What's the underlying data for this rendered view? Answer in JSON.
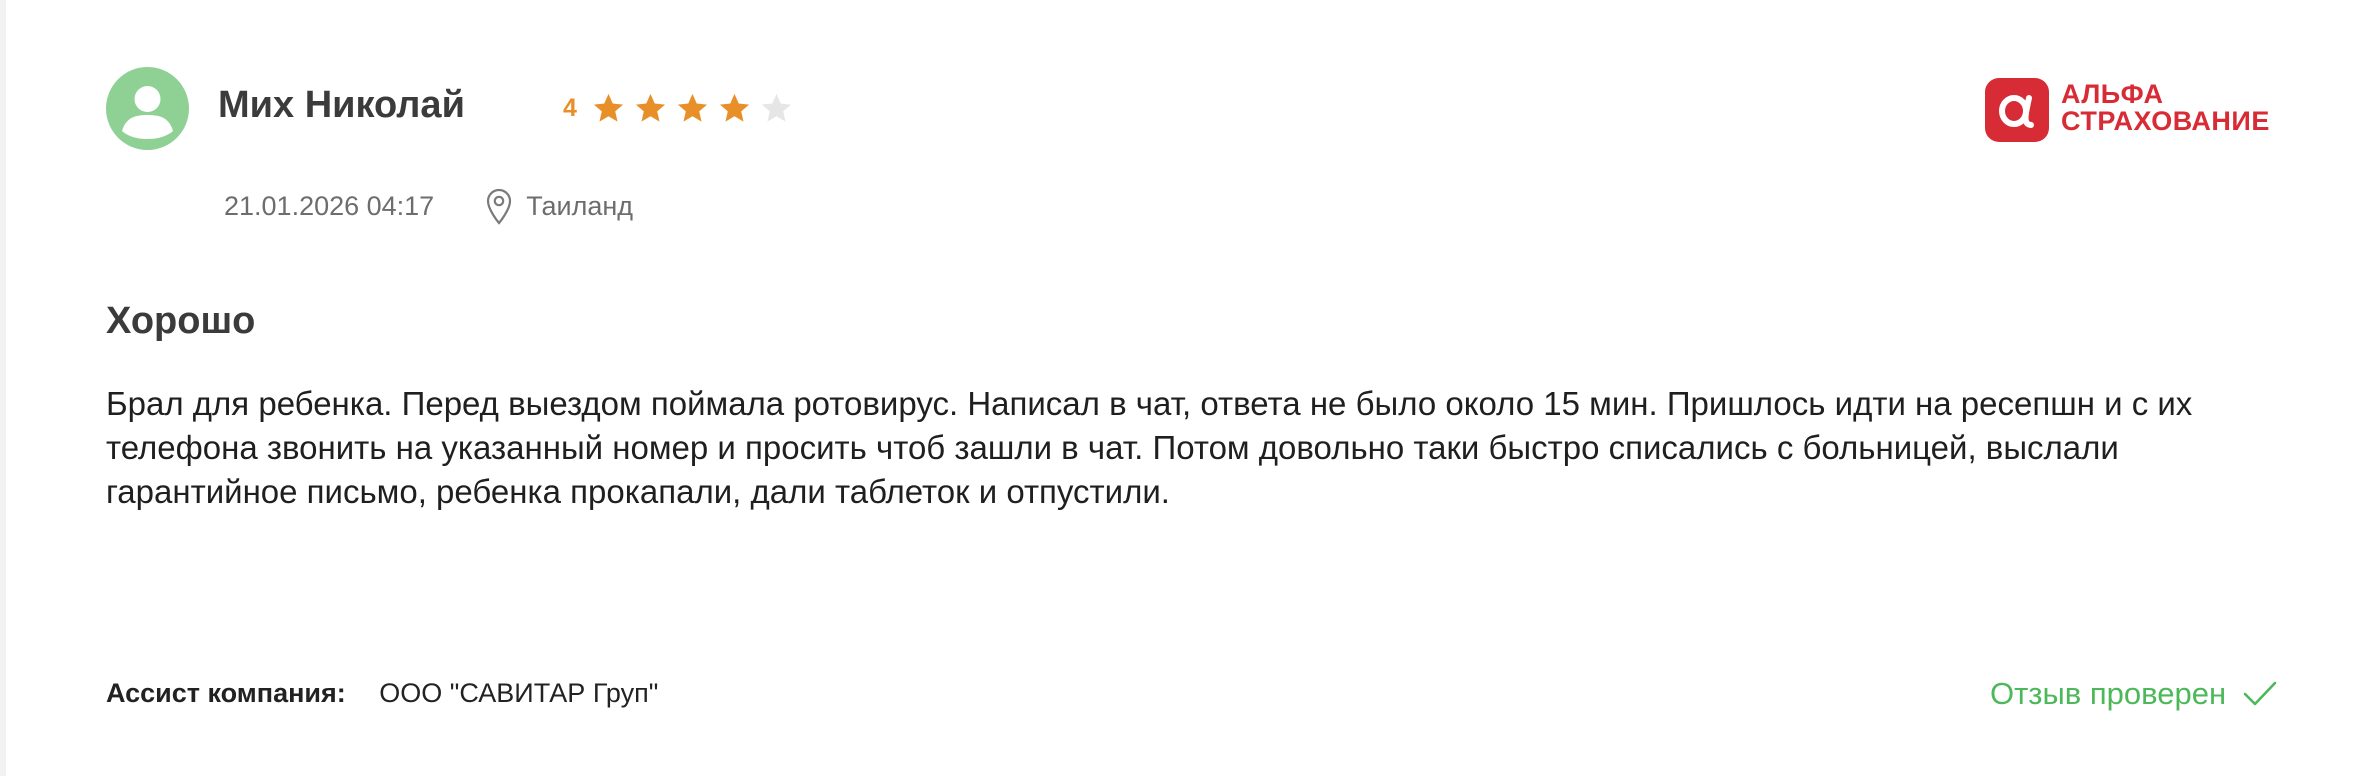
{
  "review": {
    "author": {
      "name": "Мих Николай"
    },
    "rating": {
      "value": "4",
      "stars_filled": 4,
      "stars_total": 5
    },
    "date": "21.01.2026 04:17",
    "location": {
      "icon": "location-pin-icon",
      "label": "Таиланд"
    },
    "title": "Хорошо",
    "text": "Брал для ребенка. Перед выездом поймала ротовирус. Написал в чат, ответа не было около 15 мин. Пришлось идти на ресепшн и с их телефона звонить на указанный номер и просить чтоб зашли в чат. Потом довольно таки быстро списались с больницей, выслали гарантийное письмо, ребенка прокапали, дали таблеток и отпустили.",
    "assist": {
      "label": "Ассист компания:",
      "value": "ООО \"САВИТАР Груп\""
    },
    "verified": {
      "label": "Отзыв проверен",
      "icon": "checkmark-icon"
    }
  },
  "company": {
    "logo_line1": "АЛЬФА",
    "logo_line2": "СТРАХОВАНИЕ"
  },
  "colors": {
    "avatar_bg": "#8fd095",
    "star_filled": "#e88f2a",
    "star_empty": "#e6e6e6",
    "brand": "#d72c35",
    "verified": "#4db85a"
  }
}
